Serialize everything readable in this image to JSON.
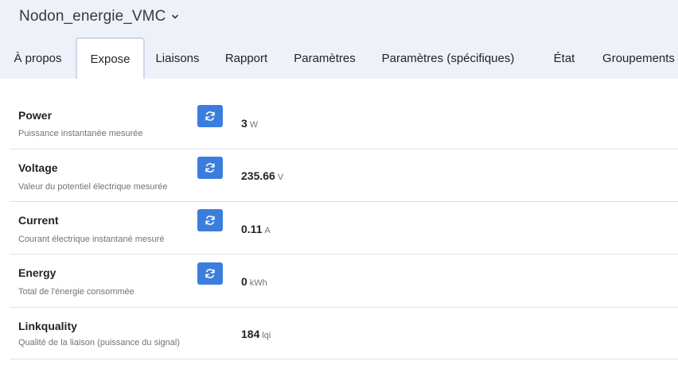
{
  "header": {
    "title": "Nodon_energie_VMC"
  },
  "tabs": [
    {
      "label": "À propos",
      "active": false
    },
    {
      "label": "Expose",
      "active": true
    },
    {
      "label": "Liaisons",
      "active": false
    },
    {
      "label": "Rapport",
      "active": false
    },
    {
      "label": "Paramètres",
      "active": false
    },
    {
      "label": "Paramètres (spécifiques)",
      "active": false
    },
    {
      "label": "État",
      "active": false
    },
    {
      "label": "Groupements",
      "active": false
    }
  ],
  "exposes": [
    {
      "name": "Power",
      "description": "Puissance instantanée mesurée",
      "value": "3",
      "unit": "W",
      "refreshable": true
    },
    {
      "name": "Voltage",
      "description": "Valeur du potentiel électrique mesurée",
      "value": "235.66",
      "unit": "V",
      "refreshable": true
    },
    {
      "name": "Current",
      "description": "Courant électrique instantané mesuré",
      "value": "0.11",
      "unit": "A",
      "refreshable": true
    },
    {
      "name": "Energy",
      "description": "Total de l'énergie consommée",
      "value": "0",
      "unit": "kWh",
      "refreshable": true
    },
    {
      "name": "Linkquality",
      "description": "Qualité de la liaison (puissance du signal)",
      "value": "184",
      "unit": "lqi",
      "refreshable": false
    }
  ],
  "colors": {
    "accent": "#3b7ddd",
    "page_background": "#eef1f8",
    "panel_background": "#ffffff",
    "muted_text": "#6c757d"
  }
}
